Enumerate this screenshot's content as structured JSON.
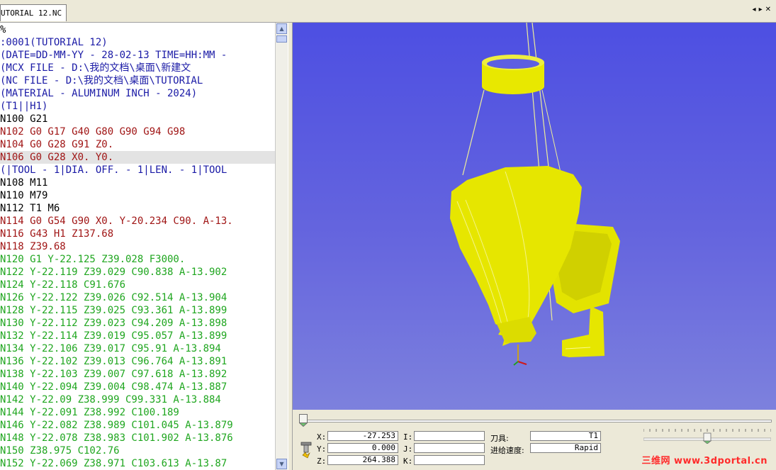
{
  "tab": {
    "title": "UTORIAL 12.NC",
    "nav": [
      "◂",
      "▸",
      "✕"
    ]
  },
  "code_lines": [
    {
      "text": "%",
      "color": "black",
      "highlight": false
    },
    {
      "text": ":0001(TUTORIAL 12)",
      "color": "blue",
      "highlight": false
    },
    {
      "text": "(DATE=DD-MM-YY - 28-02-13 TIME=HH:MM - ",
      "color": "blue",
      "highlight": false
    },
    {
      "text": "(MCX FILE - D:\\我的文档\\桌面\\新建文",
      "color": "blue",
      "highlight": false
    },
    {
      "text": "(NC FILE - D:\\我的文档\\桌面\\TUTORIAL",
      "color": "blue",
      "highlight": false
    },
    {
      "text": "(MATERIAL - ALUMINUM INCH - 2024)",
      "color": "blue",
      "highlight": false
    },
    {
      "text": "(T1||H1)",
      "color": "blue",
      "highlight": false
    },
    {
      "text": "N100 G21",
      "color": "black",
      "highlight": false
    },
    {
      "text": "N102 G0 G17 G40 G80 G90 G94 G98",
      "color": "red",
      "highlight": false
    },
    {
      "text": "N104 G0 G28 G91 Z0.",
      "color": "red",
      "highlight": false
    },
    {
      "text": "N106 G0 G28 X0. Y0.",
      "color": "red",
      "highlight": true
    },
    {
      "text": "(|TOOL - 1|DIA. OFF. - 1|LEN. - 1|TOOL",
      "color": "blue",
      "highlight": false
    },
    {
      "text": "N108 M11",
      "color": "black",
      "highlight": false
    },
    {
      "text": "N110 M79",
      "color": "black",
      "highlight": false
    },
    {
      "text": "N112 T1 M6",
      "color": "black",
      "highlight": false
    },
    {
      "text": "N114 G0 G54 G90 X0. Y-20.234 C90. A-13.",
      "color": "red",
      "highlight": false
    },
    {
      "text": "N116 G43 H1 Z137.68",
      "color": "red",
      "highlight": false
    },
    {
      "text": "N118 Z39.68",
      "color": "red",
      "highlight": false
    },
    {
      "text": "N120 G1 Y-22.125 Z39.028 F3000.",
      "color": "green",
      "highlight": false
    },
    {
      "text": "N122 Y-22.119 Z39.029 C90.838 A-13.902",
      "color": "green",
      "highlight": false
    },
    {
      "text": "N124 Y-22.118 C91.676",
      "color": "green",
      "highlight": false
    },
    {
      "text": "N126 Y-22.122 Z39.026 C92.514 A-13.904",
      "color": "green",
      "highlight": false
    },
    {
      "text": "N128 Y-22.115 Z39.025 C93.361 A-13.899",
      "color": "green",
      "highlight": false
    },
    {
      "text": "N130 Y-22.112 Z39.023 C94.209 A-13.898",
      "color": "green",
      "highlight": false
    },
    {
      "text": "N132 Y-22.114 Z39.019 C95.057 A-13.899",
      "color": "green",
      "highlight": false
    },
    {
      "text": "N134 Y-22.106 Z39.017 C95.91 A-13.894",
      "color": "green",
      "highlight": false
    },
    {
      "text": "N136 Y-22.102 Z39.013 C96.764 A-13.891",
      "color": "green",
      "highlight": false
    },
    {
      "text": "N138 Y-22.103 Z39.007 C97.618 A-13.892",
      "color": "green",
      "highlight": false
    },
    {
      "text": "N140 Y-22.094 Z39.004 C98.474 A-13.887",
      "color": "green",
      "highlight": false
    },
    {
      "text": "N142 Y-22.09 Z38.999 C99.331 A-13.884",
      "color": "green",
      "highlight": false
    },
    {
      "text": "N144 Y-22.091 Z38.992 C100.189",
      "color": "green",
      "highlight": false
    },
    {
      "text": "N146 Y-22.082 Z38.989 C101.045 A-13.879",
      "color": "green",
      "highlight": false
    },
    {
      "text": "N148 Y-22.078 Z38.983 C101.902 A-13.876",
      "color": "green",
      "highlight": false
    },
    {
      "text": "N150 Z38.975 C102.76",
      "color": "green",
      "highlight": false
    },
    {
      "text": "N152 Y-22.069 Z38.971 C103.613 A-13.87",
      "color": "green",
      "highlight": false
    }
  ],
  "colors": {
    "black": "#000000",
    "blue": "#1a1aa6",
    "red": "#a01515",
    "green": "#1fa61f",
    "toolpath": "#e8e800",
    "viewport": "#5a5ce0"
  },
  "coords": {
    "x": {
      "label": "X:",
      "value": "-27.253"
    },
    "y": {
      "label": "Y:",
      "value": "0.000"
    },
    "z": {
      "label": "Z:",
      "value": "264.388"
    },
    "i": {
      "label": "I:",
      "value": ""
    },
    "j": {
      "label": "J:",
      "value": ""
    },
    "k": {
      "label": "K:",
      "value": ""
    }
  },
  "tool": {
    "label": "刀具:",
    "value": "T1"
  },
  "feed": {
    "label": "进给速度:",
    "value": "Rapid"
  },
  "progress": 0.0,
  "speed_level": 0.5,
  "watermark": "三维网 www.3dportal.cn"
}
